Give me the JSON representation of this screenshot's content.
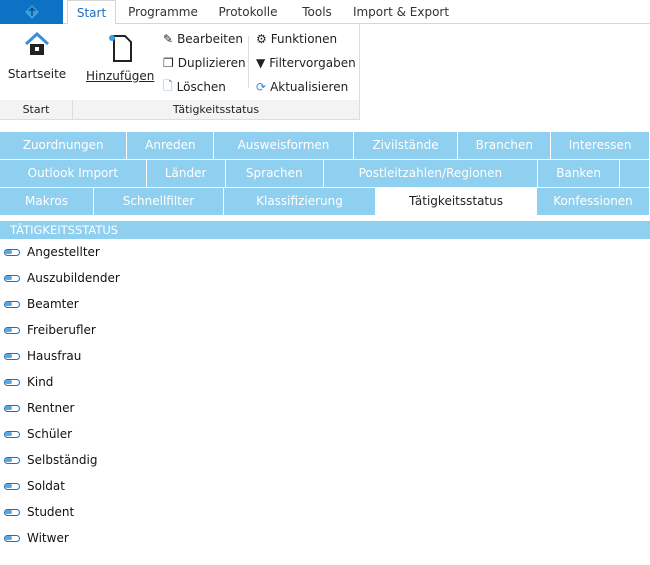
{
  "ribbon": {
    "tabs": [
      "Start",
      "Programme",
      "Protokolle",
      "Tools",
      "Import & Export"
    ],
    "active_tab": "Start",
    "startseite": "Startseite",
    "hinzufuegen": "Hinzufügen",
    "bearbeiten": "Bearbeiten",
    "duplizieren": "Duplizieren",
    "loeschen": "Löschen",
    "funktionen": "Funktionen",
    "filtervorgaben": "Filtervorgaben",
    "aktualisieren": "Aktualisieren",
    "group_start": "Start",
    "group_status": "Tätigkeitsstatus"
  },
  "page_tabs": {
    "row1": [
      "Zuordnungen",
      "Anreden",
      "Ausweisformen",
      "Zivilstände",
      "Branchen",
      "Interessen"
    ],
    "row2": [
      "Outlook Import",
      "Länder",
      "Sprachen",
      "Postleitzahlen/Regionen",
      "Banken",
      ""
    ],
    "row3": [
      "Makros",
      "Schnellfilter",
      "Klassifizierung",
      "Tätigkeitsstatus",
      "Konfessionen"
    ],
    "active": "Tätigkeitsstatus"
  },
  "list": {
    "header": "TÄTIGKEITSSTATUS",
    "items": [
      "Angestellter",
      "Auszubildender",
      "Beamter",
      "Freiberufler",
      "Hausfrau",
      "Kind",
      "Rentner",
      "Schüler",
      "Selbständig",
      "Soldat",
      "Student",
      "Witwer"
    ]
  },
  "colors": {
    "accent": "#0e72c4",
    "tab_bg": "#8fd0f0"
  }
}
